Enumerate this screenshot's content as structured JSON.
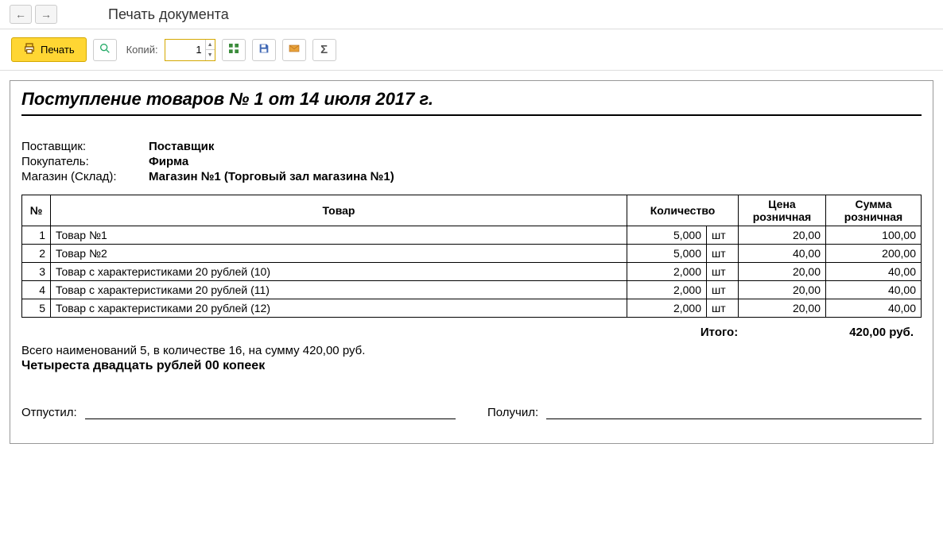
{
  "header": {
    "page_title": "Печать документа"
  },
  "toolbar": {
    "print_label": "Печать",
    "copies_label": "Копий:",
    "copies_value": "1"
  },
  "document": {
    "title": "Поступление товаров № 1 от 14 июля 2017 г.",
    "info": {
      "supplier_label": "Поставщик:",
      "supplier_value": "Поставщик",
      "buyer_label": "Покупатель:",
      "buyer_value": "Фирма",
      "store_label": "Магазин (Склад):",
      "store_value": "Магазин №1 (Торговый зал магазина №1)"
    },
    "table": {
      "headers": {
        "num": "№",
        "name": "Товар",
        "qty": "Количество",
        "price": "Цена розничная",
        "sum": "Сумма розничная"
      },
      "rows": [
        {
          "num": "1",
          "name": "Товар №1",
          "qty": "5,000",
          "unit": "шт",
          "price": "20,00",
          "sum": "100,00"
        },
        {
          "num": "2",
          "name": "Товар №2",
          "qty": "5,000",
          "unit": "шт",
          "price": "40,00",
          "sum": "200,00"
        },
        {
          "num": "3",
          "name": "Товар с характеристиками 20 рублей (10)",
          "qty": "2,000",
          "unit": "шт",
          "price": "20,00",
          "sum": "40,00"
        },
        {
          "num": "4",
          "name": "Товар с характеристиками 20 рублей (11)",
          "qty": "2,000",
          "unit": "шт",
          "price": "20,00",
          "sum": "40,00"
        },
        {
          "num": "5",
          "name": "Товар с характеристиками 20 рублей (12)",
          "qty": "2,000",
          "unit": "шт",
          "price": "20,00",
          "sum": "40,00"
        }
      ]
    },
    "totals": {
      "label": "Итого:",
      "value": "420,00 руб."
    },
    "summary": "Всего наименований 5, в количестве 16, на сумму 420,00 руб.",
    "amount_words": "Четыреста двадцать рублей 00 копеек",
    "signatures": {
      "released_label": "Отпустил:",
      "received_label": "Получил:"
    }
  }
}
